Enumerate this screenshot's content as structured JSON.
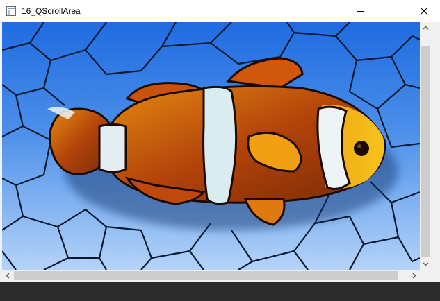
{
  "window": {
    "title": "16_QScrollArea"
  },
  "caption_buttons": {
    "minimize": "minimize-icon",
    "maximize": "maximize-icon",
    "close": "close-icon"
  },
  "colors": {
    "titlebar": "#ffffff",
    "scroll_track": "#f0f0f0",
    "scroll_thumb": "#cdcdcd",
    "taskbar": "#2b2b2b"
  }
}
